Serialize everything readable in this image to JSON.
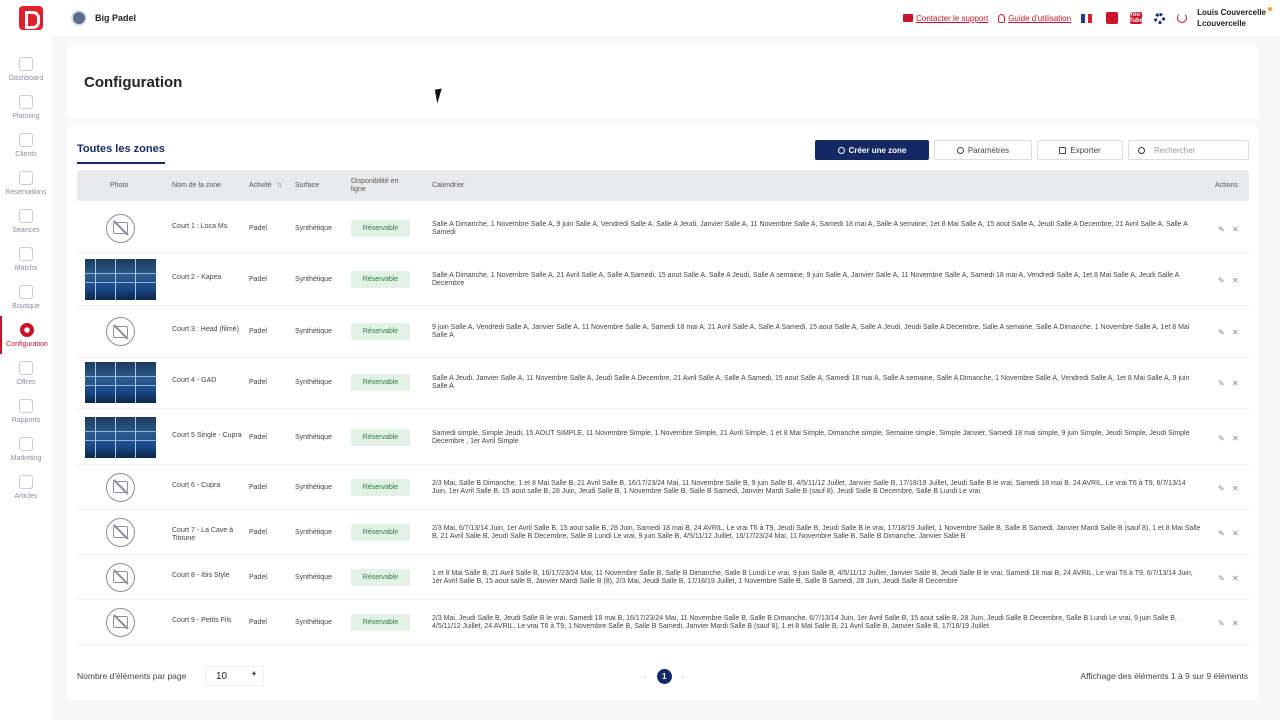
{
  "topbar": {
    "club_name": "Big Padel",
    "support_link": "Contacter le support",
    "guide_link": "Guide d'utilisation",
    "user_name": "Louis Couvercelle",
    "user_login": "Lcouvercelle",
    "youtube_label": "You Tube"
  },
  "sidebar": {
    "items": [
      {
        "label": "Dashboard",
        "icon": "dashboard-icon"
      },
      {
        "label": "Planning",
        "icon": "calendar-icon"
      },
      {
        "label": "Clients",
        "icon": "user-icon"
      },
      {
        "label": "Reservations",
        "icon": "edit-icon"
      },
      {
        "label": "Séances",
        "icon": "graduation-icon"
      },
      {
        "label": "Matchs",
        "icon": "star-icon"
      },
      {
        "label": "Boutique",
        "icon": "cart-icon"
      },
      {
        "label": "Configuration",
        "icon": "gear-icon"
      },
      {
        "label": "Offres",
        "icon": "tag-icon"
      },
      {
        "label": "Rapports",
        "icon": "pulse-icon"
      },
      {
        "label": "Marketing",
        "icon": "mail-icon"
      },
      {
        "label": "Articles",
        "icon": "globe-icon"
      }
    ]
  },
  "page": {
    "title": "Configuration"
  },
  "toolbar": {
    "tab_label": "Toutes les zones",
    "create_label": "Créer une zone",
    "settings_label": "Paramètres",
    "export_label": "Exporter",
    "search_placeholder": "Rechercher"
  },
  "table": {
    "headers": {
      "photo": "Photo",
      "name": "Nom de la zone",
      "activity": "Activité",
      "surface": "Surface",
      "availability": "Disponibilité en ligne",
      "calendar": "Calendrier",
      "actions": "Actions"
    },
    "rows": [
      {
        "photo": "placeholder",
        "name": "Court 1 : Loca Ms",
        "activity": "Padel",
        "surface": "Synthétique",
        "status": "Réservable",
        "calendar": "Salle A Dimanche, 1 Novembre Salle A, 9 juin Salle A, Vendredi Salle A, Salle A Jeudi, Janvier Salle A, 11 Novembre Salle A, Samedi 18 mai A, Salle A semaine, 1et 8 Mai Salle A, 15 aout Salle A, Jeudi Salle A Decembre, 21 Avril Salle A, Salle A Samedi"
      },
      {
        "photo": "image",
        "name": "Court 2 - Kapea",
        "activity": "Padel",
        "surface": "Synthétique",
        "status": "Réservable",
        "calendar": "Salle A Dimanche, 1 Novembre Salle A, 21 Avril Salle A, Salle A Samedi, 15 aout Salle A, Salle A Jeudi, Salle A semaine, 9 juin Salle A, Janvier Salle A, 11 Novembre Salle A, Samedi 18 mai A, Vendredi Salle A, 1et 8 Mai Salle A, Jeudi Salle A Decembre"
      },
      {
        "photo": "placeholder",
        "name": "Court 3 : Head (filmé)",
        "activity": "Padel",
        "surface": "Synthétique",
        "status": "Réservable",
        "calendar": "9 juin Salle A, Vendredi Salle A, Janvier Salle A, 11 Novembre Salle A, Samedi 18 mai A, 21 Avril Salle A, Salle A Samedi, 15 aout Salle A, Salle A Jeudi, Jeudi Salle A Decembre, Salle A semaine, Salle A Dimanche, 1 Novembre Salle A, 1et 8 Mai Salle A"
      },
      {
        "photo": "image",
        "name": "Court 4 - GAD",
        "activity": "Padel",
        "surface": "Synthétique",
        "status": "Réservable",
        "calendar": "Salle A Jeudi, Janvier Salle A, 11 Novembre Salle A, Jeudi Salle A Decembre, 21 Avril Salle A, Salle A Samedi, 15 aout Salle A, Samedi 18 mai A, Salle A semaine, Salle A Dimanche, 1 Novembre Salle A, Vendredi Salle A, 1et 8 Mai Salle A, 9 juin Salle A"
      },
      {
        "photo": "image",
        "name": "Court 5 Single - Cupra",
        "activity": "Padel",
        "surface": "Synthétique",
        "status": "Réservable",
        "calendar": "Samedi simple, Simple Jeudi, 15 AOUT SIMPLE, 11 Novembre Simple, 1 Novembre Simple, 21 Avril Simple, 1 et 8 Mai Simple, Dimanche simple, Semaine simple, Simple Janvier, Samedi 18 mai simple, 9 juin Simple, Jeudi Simple, Jeudi Simple Decembre , 1er Avril Simple"
      },
      {
        "photo": "placeholder",
        "name": "Court 6 - Cupra",
        "activity": "Padel",
        "surface": "Synthétique",
        "status": "Réservable",
        "calendar": "2/3 Mai, Salle B Dimanche, 1 et 8 Mai Salle B, 21 Avril Salle B, 16/17/23/24 Mai, 11 Novembre Salle B, 9 juin Salle B, 4/5/11/12 Juillet, Janvier Salle B, 17/18/19 Juillet, Jeudi Salle B le vrai, Samedi 18 mai B, 24 AVRIL, Le vrai T6 à T9, 6/7/13/14 Juin, 1er Avril Salle B, 15 aout salle B, 28 Juin, Jeudi Salle B, 1 Novembre Salle B, Salle B Samedi, Janvier Mardi Salle B (sauf 8), Jeudi Salle B Decembre, Salle B Lundi Le vrai"
      },
      {
        "photo": "placeholder",
        "name": "Court 7 - La Cave à Titoune",
        "activity": "Padel",
        "surface": "Synthétique",
        "status": "Réservable",
        "calendar": "2/3 Mai, 6/7/13/14 Juin, 1er Avril Salle B, 15 aout salle B, 28 Juin, Samedi 18 mai B, 24 AVRIL, Le vrai T6 à T9, Jeudi Salle B, Jeudi Salle B le vrai, 17/18/19 Juillet, 1 Novembre Salle B, Salle B Samedi, Janvier Mardi Salle B (sauf 8), 1 et 8 Mai Salle B, 21 Avril Salle B, Jeudi Salle B Decembre, Salle B Lundi Le vrai, 9 juin Salle B, 4/5/11/12 Juillet, 16/17/23/24 Mai, 11 Novembre Salle B, Salle B Dimanche, Janvier Salle B"
      },
      {
        "photo": "placeholder",
        "name": "Court 8 - Ibis Style",
        "activity": "Padel",
        "surface": "Synthétique",
        "status": "Réservable",
        "calendar": "1 et 8 Mai Salle B, 21 Avril Salle B, 16/17/23/24 Mai, 11 Novembre Salle B, Salle B Dimanche, Salle B Lundi Le vrai, 9 juin Salle B, 4/5/11/12 Juillet, Janvier Salle B, Jeudi Salle B le vrai, Samedi 18 mai B, 24 AVRIL, Le vrai T6 à T9, 6/7/13/14 Juin, 1er Avril Salle B, 15 aout salle B, Janvier Mardi Salle B (8), 2/3 Mai, Jeudi Salle B, 17/18/19 Juillet, 1 Novembre Salle B, Salle B Samedi, 28 Juin, Jeudi Salle B Decembre"
      },
      {
        "photo": "placeholder",
        "name": "Court 9 - Petits Fils",
        "activity": "Padel",
        "surface": "Synthétique",
        "status": "Réservable",
        "calendar": "2/3 Mai, Jeudi Salle B, Jeudi Salle B le vrai, Samedi 18 mai B, 16/17/23/24 Mai, 11 Novembre Salle B, Salle B Dimanche, 6/7/13/14 Juin, 1er Avril Salle B, 15 aout salle B, 28 Juin, Jeudi Salle B Decembre, Salle B Lundi Le vrai, 9 juin Salle B, 4/5/11/12 Juillet, 24 AVRIL, Le vrai T6 à T9, 1 Novembre Salle B, Salle B Samedi, Janvier Mardi Salle B (sauf 8), 1 et 8 Mai Salle B, 21 Avril Salle B, Janvier Salle B, 17/18/19 Juillet"
      }
    ]
  },
  "footer": {
    "per_page_label": "Nombre d'éléments par page",
    "per_page_value": "10",
    "current_page": "1",
    "summary": "Affichage des éléments 1 à 9 sur 9 éléments"
  },
  "colors": {
    "brand_red": "#c8142b",
    "navy": "#152866",
    "status_green": "#2e7d3a"
  }
}
